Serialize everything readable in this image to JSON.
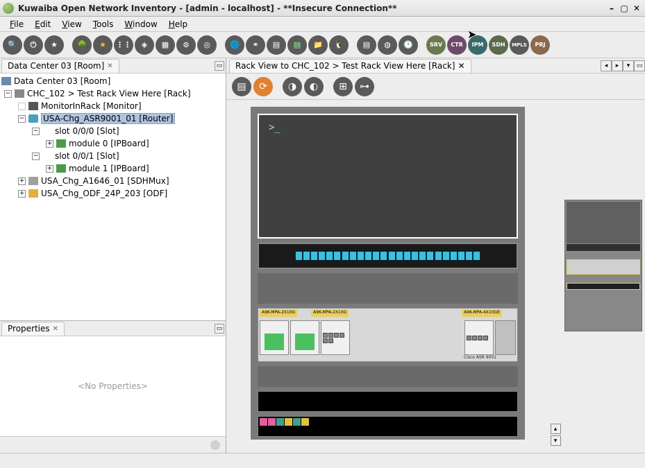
{
  "window": {
    "title": "Kuwaiba Open Network Inventory - [admin - localhost] - **Insecure Connection**"
  },
  "menu": {
    "file": "File",
    "edit": "Edit",
    "view": "View",
    "tools": "Tools",
    "window": "Window",
    "help": "Help"
  },
  "left_tab": {
    "title": "Data Center 03 [Room]"
  },
  "tree": {
    "root": "Data Center 03 [Room]",
    "rack": "CHC_102 > Test Rack View Here [Rack]",
    "monitor": "MonitorInRack [Monitor]",
    "router": "USA-Chg_ASR9001_01 [Router]",
    "slot0": "slot 0/0/0 [Slot]",
    "module0": "module 0 [IPBoard]",
    "slot1": "slot 0/0/1 [Slot]",
    "module1": "module 1 [IPBoard]",
    "sdhmux": "USA_Chg_A1646_01 [SDHMux]",
    "odf": "USA_Chg_ODF_24P_203 [ODF]"
  },
  "properties": {
    "title": "Properties",
    "empty": "<No Properties>"
  },
  "right_tab": {
    "title": "Rack View to CHC_102 > Test Rack View Here [Rack]"
  },
  "toolbar_badges": {
    "srv": "SRV",
    "ctr": "CTR",
    "ipm": "IPM",
    "sdh": "SDH",
    "mpls": "MPLS",
    "prj": "PRJ"
  },
  "asr": {
    "l1": "A9K-MPA-2X10G",
    "l2": "A9K-MPA-2X10G",
    "l3": "A9K-MPA-4X10GE",
    "model": "Cisco ASR 9001"
  }
}
